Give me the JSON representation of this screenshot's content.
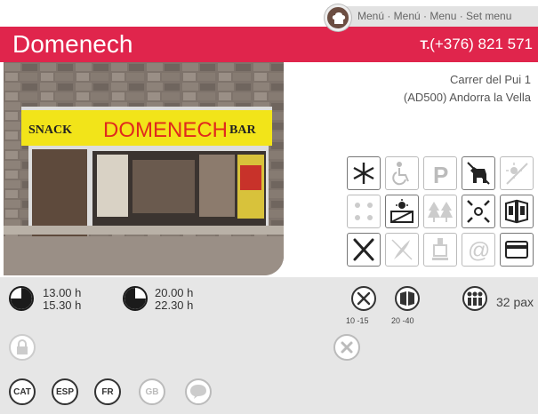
{
  "menu_links": "Menú · Menú · Menu · Set menu",
  "restaurant": {
    "name": "Domenech",
    "phone_prefix": "T.",
    "phone": "(+376) 821 571",
    "address_line1": "Carrer del Pui 1",
    "address_line2": "(AD500) Andorra la Vella",
    "sign_text_left": "SNACK",
    "sign_text_main": "DOMENECH",
    "sign_text_right": "BAR"
  },
  "hours": {
    "lunch_open": "13.00 h",
    "lunch_close": "15.30 h",
    "dinner_open": "20.00 h",
    "dinner_close": "22.30 h"
  },
  "prices": {
    "menu_price": "10 -15",
    "carte_price": "20 -40"
  },
  "capacity": "32 pax",
  "languages": [
    "CAT",
    "ESP",
    "FR",
    "GB"
  ],
  "services": [
    {
      "icon": "air-conditioning-icon",
      "active": true
    },
    {
      "icon": "wheelchair-access-icon",
      "active": false
    },
    {
      "icon": "parking-icon",
      "active": false
    },
    {
      "icon": "pets-allowed-icon",
      "active": true
    },
    {
      "icon": "no-terrace-icon",
      "active": false
    },
    {
      "icon": "terrace-icon",
      "active": false
    },
    {
      "icon": "sun-terrace-icon",
      "active": true
    },
    {
      "icon": "mountain-views-icon",
      "active": false
    },
    {
      "icon": "central-location-icon",
      "active": true
    },
    {
      "icon": "menu-book-icon",
      "active": true
    },
    {
      "icon": "cutlery-icon",
      "active": true
    },
    {
      "icon": "vegetarian-icon",
      "active": false
    },
    {
      "icon": "wine-cellar-icon",
      "active": false
    },
    {
      "icon": "email-icon",
      "active": false
    },
    {
      "icon": "credit-card-icon",
      "active": true
    }
  ]
}
